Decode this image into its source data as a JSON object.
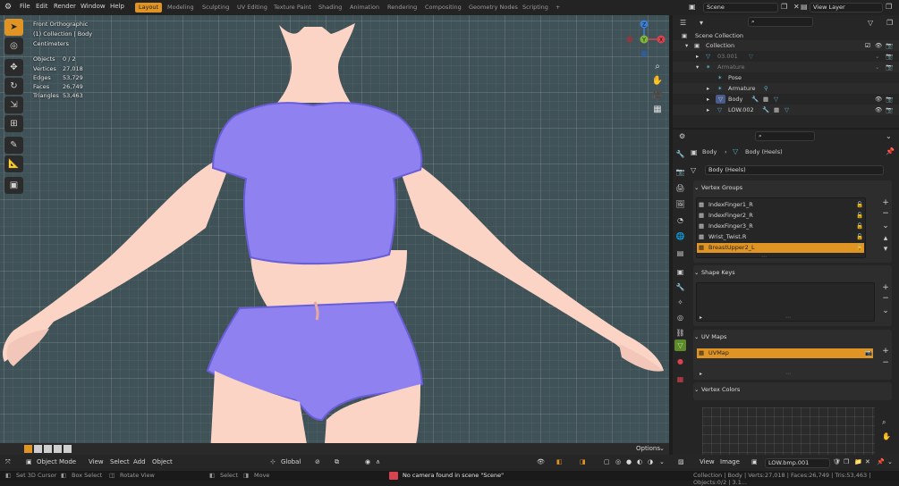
{
  "topbar": {
    "menus": [
      "File",
      "Edit",
      "Render",
      "Window",
      "Help"
    ],
    "workspaces": [
      "Layout",
      "Modeling",
      "Sculpting",
      "UV Editing",
      "Texture Paint",
      "Shading",
      "Animation",
      "Rendering",
      "Compositing",
      "Geometry Nodes",
      "Scripting"
    ],
    "active_workspace": "Layout",
    "add_tab": "+",
    "scene": "Scene",
    "view_layer": "View Layer"
  },
  "viewport": {
    "view_name": "Front Orthographic",
    "collection_path": "(1) Collection | Body",
    "units": "Centimeters",
    "stats": [
      {
        "label": "Objects",
        "value": "0 / 2"
      },
      {
        "label": "Vertices",
        "value": "27,018"
      },
      {
        "label": "Edges",
        "value": "53,729"
      },
      {
        "label": "Faces",
        "value": "26,749"
      },
      {
        "label": "Triangles",
        "value": "53,463"
      }
    ],
    "options_label": "Options",
    "gizmo": {
      "z": "Z",
      "y": "Y",
      "x": "X"
    }
  },
  "viewport_header": {
    "mode": "Object Mode",
    "menus": [
      "View",
      "Select",
      "Add",
      "Object"
    ],
    "transform": "Global"
  },
  "outliner": {
    "root": "Scene Collection",
    "rows": [
      {
        "name": "Collection",
        "dim": false
      },
      {
        "name": "03.001",
        "dim": true
      },
      {
        "name": "Armature",
        "dim": true
      },
      {
        "name": "Pose",
        "dim": false
      },
      {
        "name": "Armature",
        "dim": false
      },
      {
        "name": "Body",
        "dim": false
      },
      {
        "name": "LOW.002",
        "dim": false
      }
    ]
  },
  "properties": {
    "breadcrumb_object": "Body",
    "breadcrumb_data": "Body (Heels)",
    "data_name": "Body (Heels)",
    "vertex_groups_title": "Vertex Groups",
    "vertex_groups": [
      "IndexFinger1_R",
      "IndexFinger2_R",
      "IndexFinger3_R",
      "Wrist_Twist.R",
      "BreastUpper2_L"
    ],
    "selected_vertex_group": "BreastUpper2_L",
    "shape_keys_title": "Shape Keys",
    "uv_maps_title": "UV Maps",
    "uv_map": "UVMap",
    "vertex_colors_title": "Vertex Colors"
  },
  "image_editor": {
    "menus": [
      "View",
      "Image"
    ],
    "image_name": "LOW.bmp.001"
  },
  "statusbar": {
    "left": [
      {
        "label": "Set 3D Cursor"
      },
      {
        "label": "Box Select"
      },
      {
        "label": "Rotate View"
      },
      {
        "label": "Select"
      },
      {
        "label": "Move"
      }
    ],
    "warning": "No camera found in scene \"Scene\"",
    "stats": "Collection | Body | Verts:27,018 | Faces:26,749 | Tris:53,463 | Objects:0/2 | 3.1..."
  },
  "colors": {
    "accent": "#e09423",
    "viewport_bg": "#3f5258",
    "skin": "#fbd4c6",
    "cloth": "#8f82f0"
  }
}
